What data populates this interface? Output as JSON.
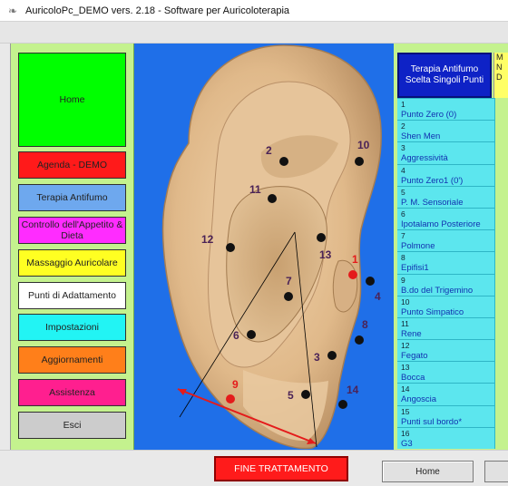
{
  "window": {
    "title": "AuricoloPc_DEMO  vers. 2.18 - Software per Auricoloterapia",
    "app_icon": "ear-icon"
  },
  "menu": [
    {
      "id": "home",
      "label": "Home",
      "color": "#00ff00"
    },
    {
      "id": "agenda",
      "label": "Agenda - DEMO",
      "color": "#ff1a1a"
    },
    {
      "id": "antifumo",
      "label": "Terapia Antifumo",
      "color": "#6ea8ee"
    },
    {
      "id": "appetito",
      "label": "Controllo dell'Appetito & Dieta",
      "color": "#ff2cff"
    },
    {
      "id": "massaggio",
      "label": "Massaggio Auricolare",
      "color": "#ffff22"
    },
    {
      "id": "adattamento",
      "label": "Punti di Adattamento",
      "color": "#ffffff"
    },
    {
      "id": "impostazioni",
      "label": "Impostazioni",
      "color": "#22f4f4"
    },
    {
      "id": "aggiornamenti",
      "label": "Aggiornamenti",
      "color": "#ff7f1a"
    },
    {
      "id": "assistenza",
      "label": "Assistenza",
      "color": "#ff1f8f"
    },
    {
      "id": "esci",
      "label": "Esci",
      "color": "#cccccc"
    }
  ],
  "right_panel": {
    "header": "Terapia Antifumo Scelta Singoli  Punti",
    "side_header": "M N D"
  },
  "points": [
    {
      "num": "1",
      "name": "Punto Zero (0)"
    },
    {
      "num": "2",
      "name": "Shen Men"
    },
    {
      "num": "3",
      "name": "Aggressività"
    },
    {
      "num": "4",
      "name": "Punto Zero1 (0')"
    },
    {
      "num": "5",
      "name": "P. M. Sensoriale"
    },
    {
      "num": "6",
      "name": "Ipotalamo Posteriore"
    },
    {
      "num": "7",
      "name": "Polmone"
    },
    {
      "num": "8",
      "name": "Epifisi1"
    },
    {
      "num": "9",
      "name": "B.do del Trigemino"
    },
    {
      "num": "10",
      "name": "Punto Simpatico"
    },
    {
      "num": "11",
      "name": "Rene"
    },
    {
      "num": "12",
      "name": "Fegato"
    },
    {
      "num": "13",
      "name": "Bocca"
    },
    {
      "num": "14",
      "name": "Angoscia"
    },
    {
      "num": "15",
      "name": "Punti sul bordo*"
    },
    {
      "num": "16",
      "name": "G3"
    }
  ],
  "ear_labels": {
    "p1": "1",
    "p2": "2",
    "p3": "3",
    "p4": "4",
    "p5": "5",
    "p6": "6",
    "p7": "7",
    "p8": "8",
    "p9": "9",
    "p10": "10",
    "p11": "11",
    "p12": "12",
    "p13": "13",
    "p14": "14"
  },
  "colors": {
    "highlight_point": "#e41b1b",
    "point": "#111111",
    "ear_bg": "#1f6fe8",
    "panel_green": "#c4f28e"
  },
  "bottom": {
    "fine_trattamento": "FINE TRATTAMENTO",
    "home": "Home"
  }
}
